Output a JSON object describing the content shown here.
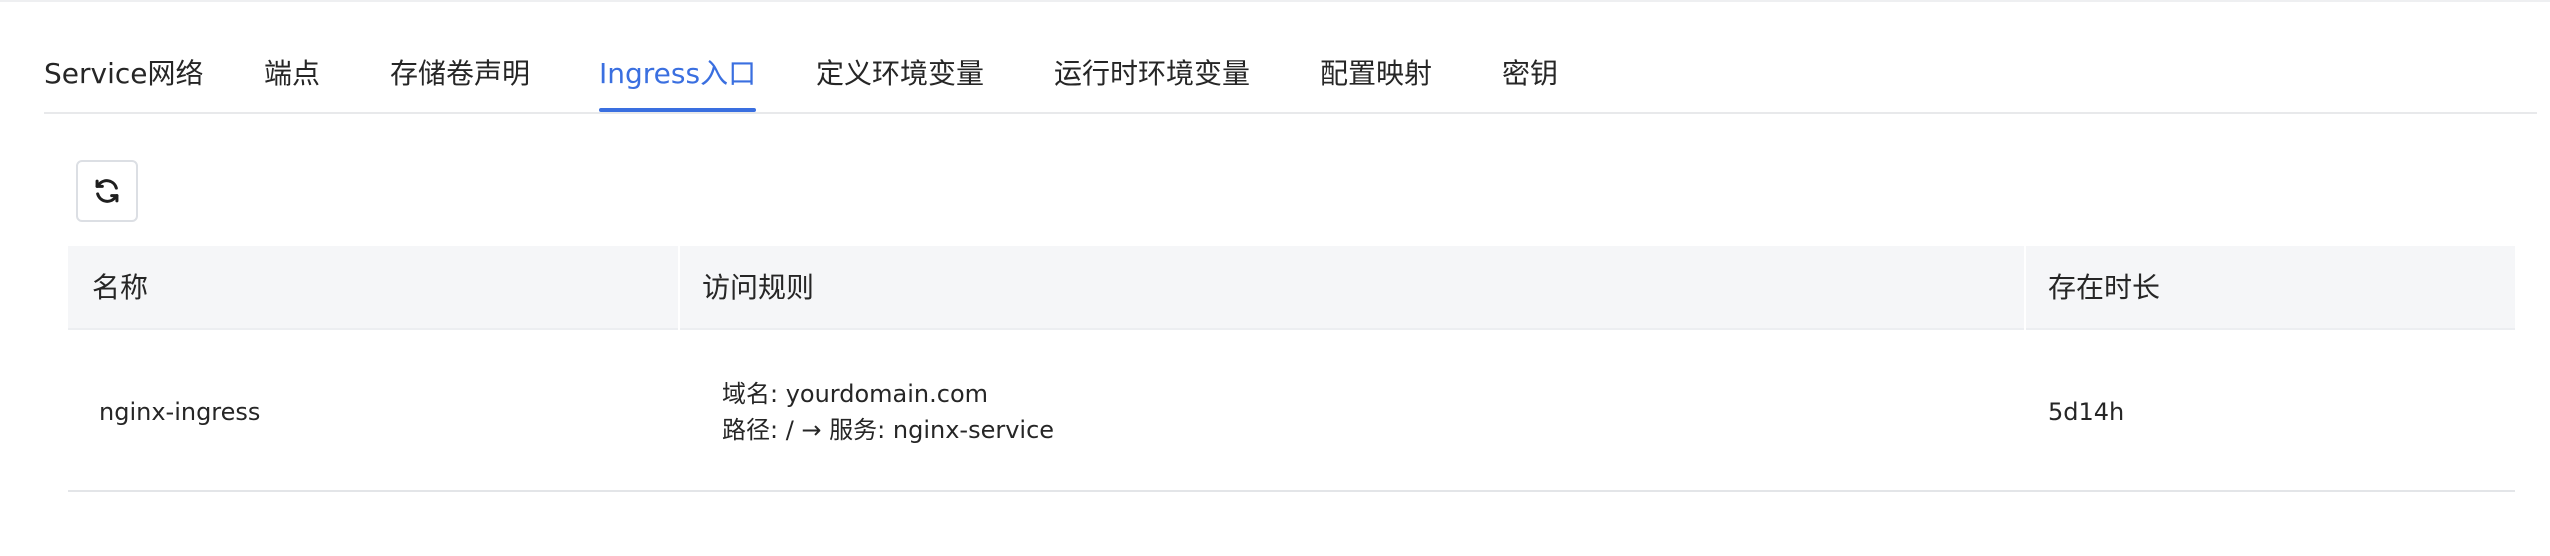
{
  "tabs": [
    {
      "label": "Service网络",
      "active": false
    },
    {
      "label": "端点",
      "active": false
    },
    {
      "label": "存储卷声明",
      "active": false
    },
    {
      "label": "Ingress入口",
      "active": true
    },
    {
      "label": "定义环境变量",
      "active": false
    },
    {
      "label": "运行时环境变量",
      "active": false
    },
    {
      "label": "配置映射",
      "active": false
    },
    {
      "label": "密钥",
      "active": false
    }
  ],
  "toolbar": {
    "refresh_icon": "refresh-icon"
  },
  "table": {
    "columns": [
      "名称",
      "访问规则",
      "存在时长"
    ],
    "rows": [
      {
        "name": "nginx-ingress",
        "rule_domain": "域名: yourdomain.com",
        "rule_path": "路径: / → 服务: nginx-service",
        "age": "5d14h"
      }
    ]
  },
  "colors": {
    "accent": "#3a6fe0",
    "header_bg": "#f5f6f8",
    "text": "#262626"
  }
}
